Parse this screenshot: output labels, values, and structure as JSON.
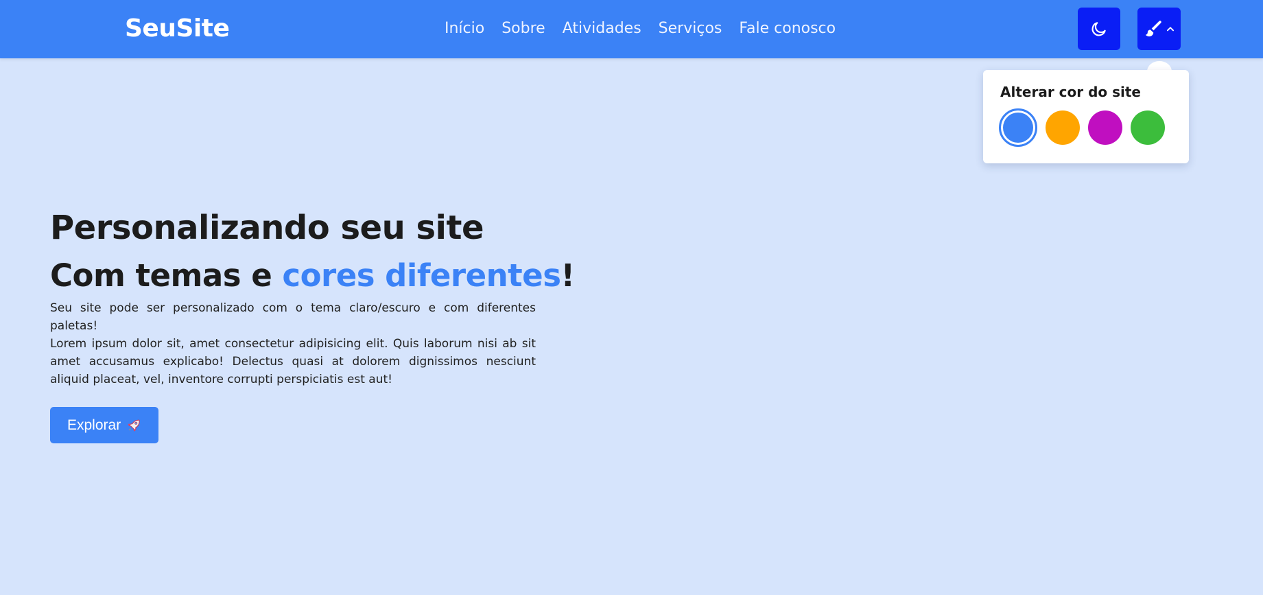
{
  "header": {
    "brand": "SeuSite",
    "nav": [
      "Início",
      "Sobre",
      "Atividades",
      "Serviços",
      "Fale conosco"
    ],
    "theme_toggle_icon": "moon-icon",
    "palette_icon": "paintbrush-icon",
    "palette_chevron_icon": "chevron-up-icon"
  },
  "color_menu": {
    "title": "Alterar cor do site",
    "swatches": [
      {
        "name": "blue",
        "color": "#3b82f6",
        "selected": true
      },
      {
        "name": "orange",
        "color": "#ffa500",
        "selected": false
      },
      {
        "name": "magenta",
        "color": "#c00fc0",
        "selected": false
      },
      {
        "name": "green",
        "color": "#3cbd3c",
        "selected": false
      }
    ]
  },
  "hero": {
    "title": "Personalizando seu site",
    "subtitle_prefix": "Com temas e ",
    "subtitle_highlight": "cores diferentes",
    "subtitle_suffix": "!",
    "paragraph_1": "Seu site pode ser personalizado com o tema claro/escuro e com diferentes paletas!",
    "paragraph_2": "Lorem ipsum dolor sit, amet consectetur adipisicing elit. Quis laborum nisi ab sit amet accusamus explicabo! Delectus quasi at dolorem dignissimos nesciunt aliquid placeat, vel, inventore corrupti perspiciatis est aut!",
    "cta_label": "Explorar",
    "cta_icon": "rocket-icon"
  },
  "colors": {
    "primary": "#3b82f6",
    "button_dark": "#0a1ef5",
    "background": "#d6e4fc"
  }
}
